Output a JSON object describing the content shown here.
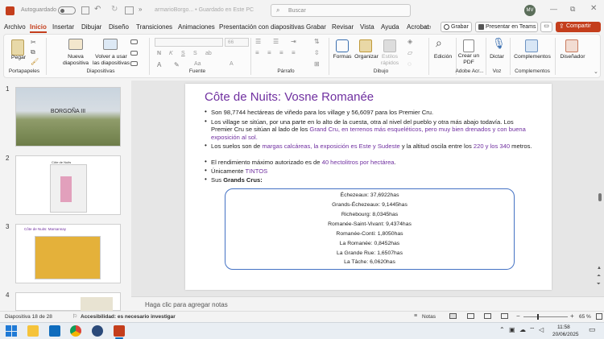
{
  "titlebar": {
    "autosave": "Autoguardado",
    "filename": "armarioBorgo... • Guardado en Este PC",
    "search_placeholder": "Buscar",
    "avatar": "MV"
  },
  "tabs": [
    "Archivo",
    "Inicio",
    "Insertar",
    "Dibujar",
    "Diseño",
    "Transiciones",
    "Animaciones",
    "Presentación con diapositivas",
    "Grabar",
    "Revisar",
    "Vista",
    "Ayuda",
    "Acrobat"
  ],
  "tab_buttons": {
    "record": "Grabar",
    "present": "Presentar en Teams",
    "share": "Compartir"
  },
  "ribbon": {
    "paste": "Pegar",
    "new_slide": "Nueva diapositiva",
    "reuse": "Volver a usar las diapositivas",
    "font_size": "66",
    "shapes": "Formas",
    "arrange": "Organizar",
    "quick_styles": "Estilos rápidos",
    "edit": "Edición",
    "create_pdf": "Crear un PDF",
    "dictate": "Dictar",
    "addins": "Complementos",
    "designer": "Diseñador",
    "groups": [
      "Portapapeles",
      "Diapositivas",
      "Fuente",
      "Párrafo",
      "Dibujo",
      "Adobe Acr...",
      "Voz",
      "Complementos"
    ]
  },
  "thumbnails": [
    {
      "num": "1",
      "title": "BORGOÑA III"
    },
    {
      "num": "2",
      "title": "Côte de Nuits"
    },
    {
      "num": "3",
      "title": "Côte de Nuits: Marsannay"
    },
    {
      "num": "4",
      "title": ""
    }
  ],
  "slide": {
    "title": "Côte de Nuits: Vosne Romanée",
    "b1": "Son 98,7744 hectáreas de viñedo para los village y 56,6097 para los Premier Cru.",
    "b2a": "Los village se sitúan, por una parte en lo alto de la cuesta, otra al nivel del pueblo y otra más abajo todavía. Los Premier Cru se sitúan al lado de los ",
    "b2b": "Grand Cru, en terrenos más esqueléticos, pero muy bien drenados y con buena exposición al sol.",
    "b3a": "Los suelos son de ",
    "b3b": "margas calcáreas, la exposición es Este y Sudeste",
    "b3c": " y la altitud oscila entre los ",
    "b3d": "220 y los 340",
    "b3e": " metros.",
    "b4a": "El rendimiento máximo autorizado es de ",
    "b4b": "40 hectolitros por hectárea",
    "b4c": ".",
    "b5a": "Únicamente ",
    "b5b": "TINTOS",
    "b6a": "Sus ",
    "b6b": "Grands Crus:",
    "crus": [
      "Échezeaux: 37,6922has",
      "Grands-Échezeaux: 9,1445has",
      "Richebourg: 8,0345has",
      "Romanée-Saint-Vivant: 9,4374has",
      "Romanée-Conti: 1,8050has",
      "La Romanée: 0,8452has",
      "La Grande Rue: 1,6507has",
      "La Tâche: 6,0620has"
    ]
  },
  "notes_placeholder": "Haga clic para agregar notas",
  "status": {
    "slide_count": "Diapositiva 18 de 28",
    "accessibility": "Accesibilidad: es necesario investigar",
    "notes": "Notas",
    "zoom": "65 %"
  },
  "taskbar": {
    "time": "11:58",
    "date": "20/06/2025"
  },
  "colors": {
    "accent": "#c43e1c",
    "title": "#7030a0",
    "border": "#4472c4"
  }
}
